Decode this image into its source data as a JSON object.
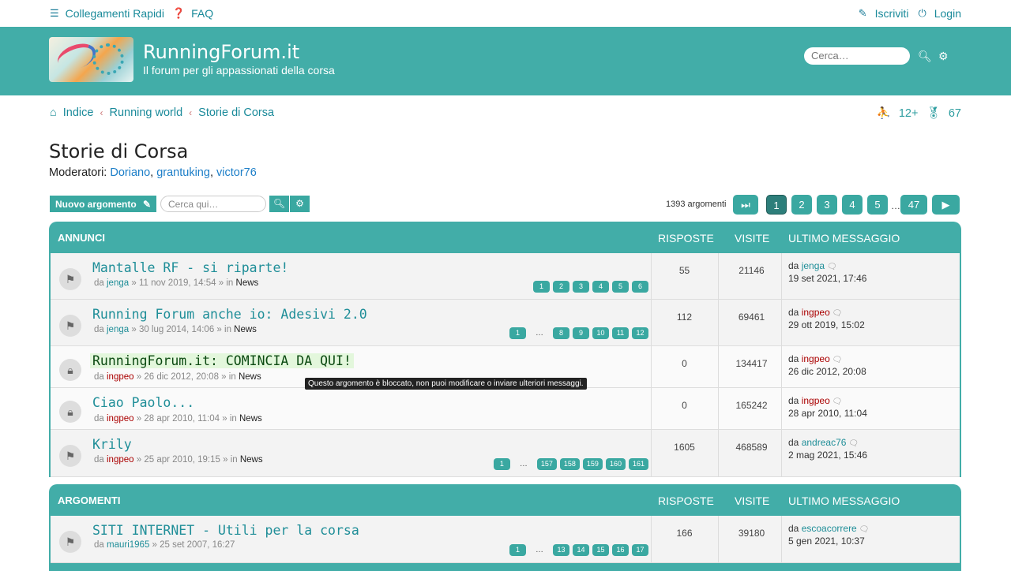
{
  "topbar": {
    "quick_links": "Collegamenti Rapidi",
    "faq": "FAQ",
    "register": "Iscriviti",
    "login": "Login"
  },
  "header": {
    "title": "RunningForum.it",
    "description": "Il forum per gli appassionati della corsa",
    "search_placeholder": "Cerca…"
  },
  "breadcrumbs": [
    "Indice",
    "Running world",
    "Storie di Corsa"
  ],
  "stats": {
    "online": "12+",
    "medals": "67"
  },
  "forum": {
    "title": "Storie di Corsa",
    "moderators_label": "Moderatori:",
    "moderators": [
      "Doriano",
      "grantuking",
      "victor76"
    ],
    "new_topic": "Nuovo argomento",
    "search_placeholder": "Cerca qui…",
    "topic_count": "1393 argomenti"
  },
  "pagination": [
    "1",
    "2",
    "3",
    "4",
    "5",
    "…",
    "47"
  ],
  "columns": {
    "replies": "RISPOSTE",
    "views": "VISITE",
    "last_post": "ULTIMO MESSAGGIO"
  },
  "announcements": {
    "header": "ANNUNCI",
    "rows": [
      {
        "title": "Mantalle RF - si riparte!",
        "author": "jenga",
        "date": "11 nov 2019, 14:54",
        "forum": "News",
        "pages": [
          "1",
          "2",
          "3",
          "4",
          "5",
          "6"
        ],
        "replies": "55",
        "views": "21146",
        "last_by": "jenga",
        "last_date": "19 set 2021, 17:46"
      },
      {
        "title": "Running Forum anche io: Adesivi 2.0",
        "author": "jenga",
        "date": "30 lug 2014, 14:06",
        "forum": "News",
        "pages": [
          "1",
          "…",
          "8",
          "9",
          "10",
          "11",
          "12"
        ],
        "replies": "112",
        "views": "69461",
        "last_by": "ingpeo",
        "last_date": "29 ott 2019, 15:02"
      },
      {
        "title": "RunningForum.it: COMINCIA DA QUI!",
        "author": "ingpeo",
        "date": "26 dic 2012, 20:08",
        "forum": "News",
        "pages": [],
        "replies": "0",
        "views": "134417",
        "last_by": "ingpeo",
        "last_date": "26 dic 2012, 20:08"
      },
      {
        "title": "Ciao Paolo...",
        "author": "ingpeo",
        "date": "28 apr 2010, 11:04",
        "forum": "News",
        "pages": [],
        "replies": "0",
        "views": "165242",
        "last_by": "ingpeo",
        "last_date": "28 apr 2010, 11:04"
      },
      {
        "title": "Krily",
        "author": "ingpeo",
        "date": "25 apr 2010, 19:15",
        "forum": "News",
        "pages": [
          "1",
          "…",
          "157",
          "158",
          "159",
          "160",
          "161"
        ],
        "replies": "1605",
        "views": "468589",
        "last_by": "andreac76",
        "last_date": "2 mag 2021, 15:46"
      }
    ]
  },
  "topics": {
    "header": "ARGOMENTI",
    "rows": [
      {
        "title": "SITI INTERNET - Utili per la corsa",
        "author": "mauri1965",
        "date": "25 set 2007, 16:27",
        "pages": [
          "1",
          "…",
          "13",
          "14",
          "15",
          "16",
          "17"
        ],
        "replies": "166",
        "views": "39180",
        "last_by": "escoacorrere",
        "last_date": "5 gen 2021, 10:37"
      }
    ]
  },
  "tooltip": "Questo argomento è bloccato, non puoi modificare o inviare ulteriori messaggi.",
  "labels": {
    "by": "da",
    "in": "in"
  }
}
